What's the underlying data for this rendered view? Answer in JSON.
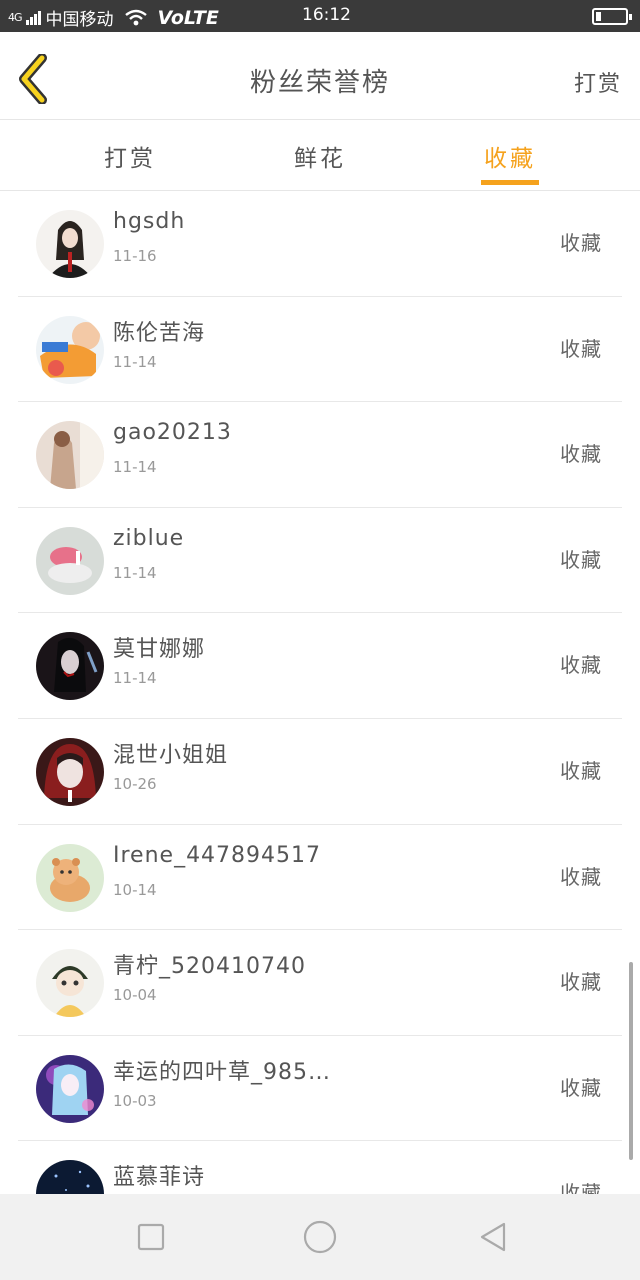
{
  "status_bar": {
    "signal": "4G",
    "carrier": "中国移动",
    "network": "VoLTE",
    "time": "16:12"
  },
  "header": {
    "title": "粉丝荣誉榜",
    "action_label": "打赏"
  },
  "tabs": [
    {
      "label": "打赏",
      "active": false
    },
    {
      "label": "鲜花",
      "active": false
    },
    {
      "label": "收藏",
      "active": true
    }
  ],
  "accent_color": "#f5a21d",
  "list": [
    {
      "name": "hgsdh",
      "date": "11-16",
      "type": "收藏"
    },
    {
      "name": "陈伦苦海",
      "date": "11-14",
      "type": "收藏"
    },
    {
      "name": "gao20213",
      "date": "11-14",
      "type": "收藏"
    },
    {
      "name": "ziblue",
      "date": "11-14",
      "type": "收藏"
    },
    {
      "name": "莫甘娜娜",
      "date": "11-14",
      "type": "收藏"
    },
    {
      "name": "混世小姐姐",
      "date": "10-26",
      "type": "收藏"
    },
    {
      "name": "Irene_447894517",
      "date": "10-14",
      "type": "收藏"
    },
    {
      "name": "青柠_520410740",
      "date": "10-04",
      "type": "收藏"
    },
    {
      "name": "幸运的四叶草_985…",
      "date": "10-03",
      "type": "收藏"
    },
    {
      "name": "蓝慕菲诗",
      "date": "",
      "type": "收藏"
    }
  ],
  "navbar": {
    "icons": [
      "recent-apps-icon",
      "home-icon",
      "back-triangle-icon"
    ]
  }
}
